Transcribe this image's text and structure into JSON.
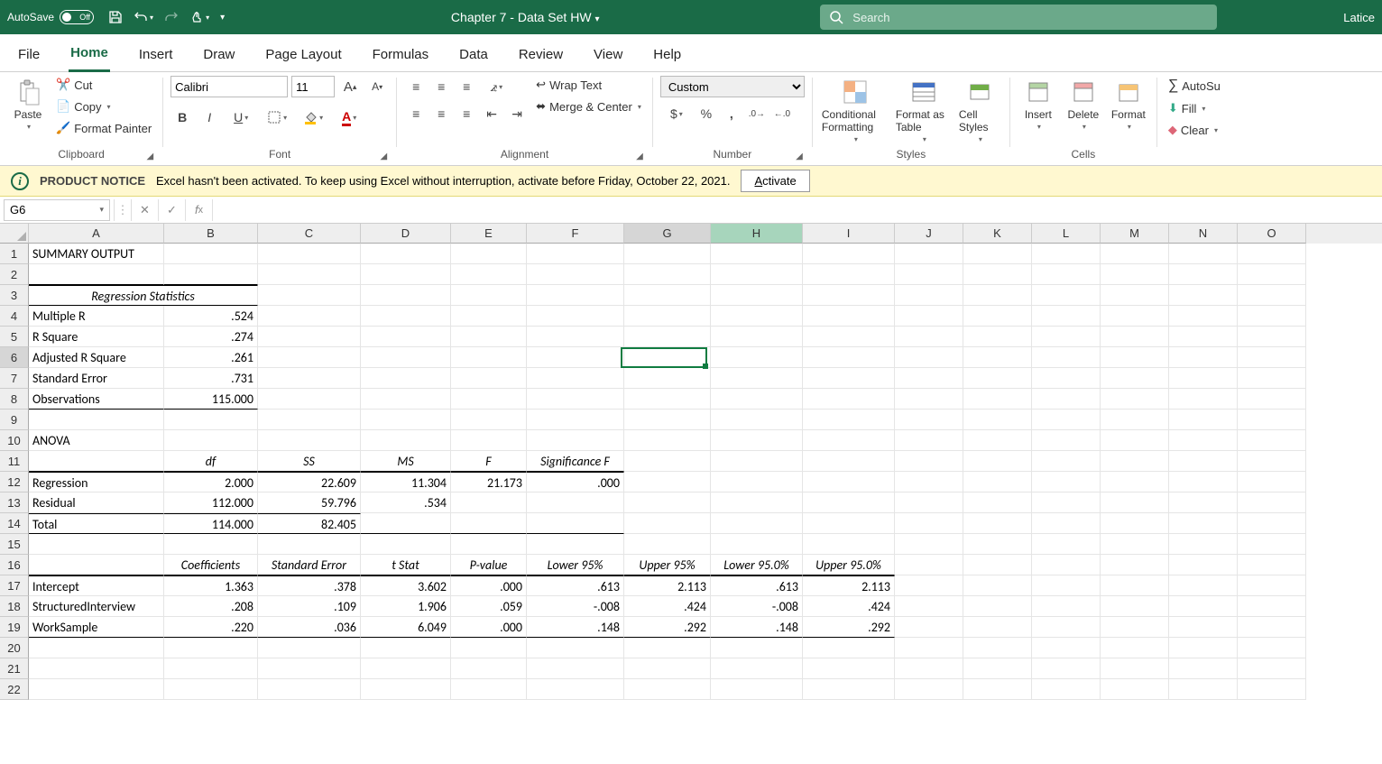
{
  "titlebar": {
    "autosave_label": "AutoSave",
    "autosave_state": "Off",
    "doc_title": "Chapter 7 - Data Set HW",
    "search_placeholder": "Search",
    "user": "Latice"
  },
  "tabs": [
    "File",
    "Home",
    "Insert",
    "Draw",
    "Page Layout",
    "Formulas",
    "Data",
    "Review",
    "View",
    "Help"
  ],
  "active_tab": "Home",
  "clipboard": {
    "paste": "Paste",
    "cut": "Cut",
    "copy": "Copy",
    "painter": "Format Painter",
    "label": "Clipboard"
  },
  "font": {
    "name": "Calibri",
    "size": "11",
    "label": "Font"
  },
  "alignment": {
    "wrap": "Wrap Text",
    "merge": "Merge & Center",
    "label": "Alignment"
  },
  "number": {
    "format": "Custom",
    "label": "Number"
  },
  "styles": {
    "cond": "Conditional Formatting",
    "table": "Format as Table",
    "cell": "Cell Styles",
    "label": "Styles"
  },
  "cells": {
    "insert": "Insert",
    "delete": "Delete",
    "format": "Format",
    "label": "Cells"
  },
  "editing": {
    "autosum": "AutoSu",
    "fill": "Fill",
    "clear": "Clear"
  },
  "notice": {
    "title": "PRODUCT NOTICE",
    "msg": "Excel hasn't been activated. To keep using Excel without interruption, activate before Friday, October 22, 2021.",
    "btn": "Activate"
  },
  "namebox": "G6",
  "columns": [
    "A",
    "B",
    "C",
    "D",
    "E",
    "F",
    "G",
    "H",
    "I",
    "J",
    "K",
    "L",
    "M",
    "N",
    "O"
  ],
  "cells_data": {
    "A1": "SUMMARY OUTPUT",
    "A3": "Regression Statistics",
    "A4": "Multiple R",
    "B4": ".524",
    "A5": "R Square",
    "B5": ".274",
    "A6": "Adjusted R Square",
    "B6": ".261",
    "A7": "Standard Error",
    "B7": ".731",
    "A8": "Observations",
    "B8": "115.000",
    "A10": "ANOVA",
    "B11": "df",
    "C11": "SS",
    "D11": "MS",
    "E11": "F",
    "F11": "Significance F",
    "A12": "Regression",
    "B12": "2.000",
    "C12": "22.609",
    "D12": "11.304",
    "E12": "21.173",
    "F12": ".000",
    "A13": "Residual",
    "B13": "112.000",
    "C13": "59.796",
    "D13": ".534",
    "A14": "Total",
    "B14": "114.000",
    "C14": "82.405",
    "B16": "Coefficients",
    "C16": "Standard Error",
    "D16": "t Stat",
    "E16": "P-value",
    "F16": "Lower 95%",
    "G16": "Upper 95%",
    "H16": "Lower 95.0%",
    "I16": "Upper 95.0%",
    "A17": "Intercept",
    "B17": "1.363",
    "C17": ".378",
    "D17": "3.602",
    "E17": ".000",
    "F17": ".613",
    "G17": "2.113",
    "H17": ".613",
    "I17": "2.113",
    "A18": "StructuredInterview",
    "B18": ".208",
    "C18": ".109",
    "D18": "1.906",
    "E18": ".059",
    "F18": "-.008",
    "G18": ".424",
    "H18": "-.008",
    "I18": ".424",
    "A19": "WorkSample",
    "B19": ".220",
    "C19": ".036",
    "D19": "6.049",
    "E19": ".000",
    "F19": ".148",
    "G19": ".292",
    "H19": ".148",
    "I19": ".292"
  }
}
